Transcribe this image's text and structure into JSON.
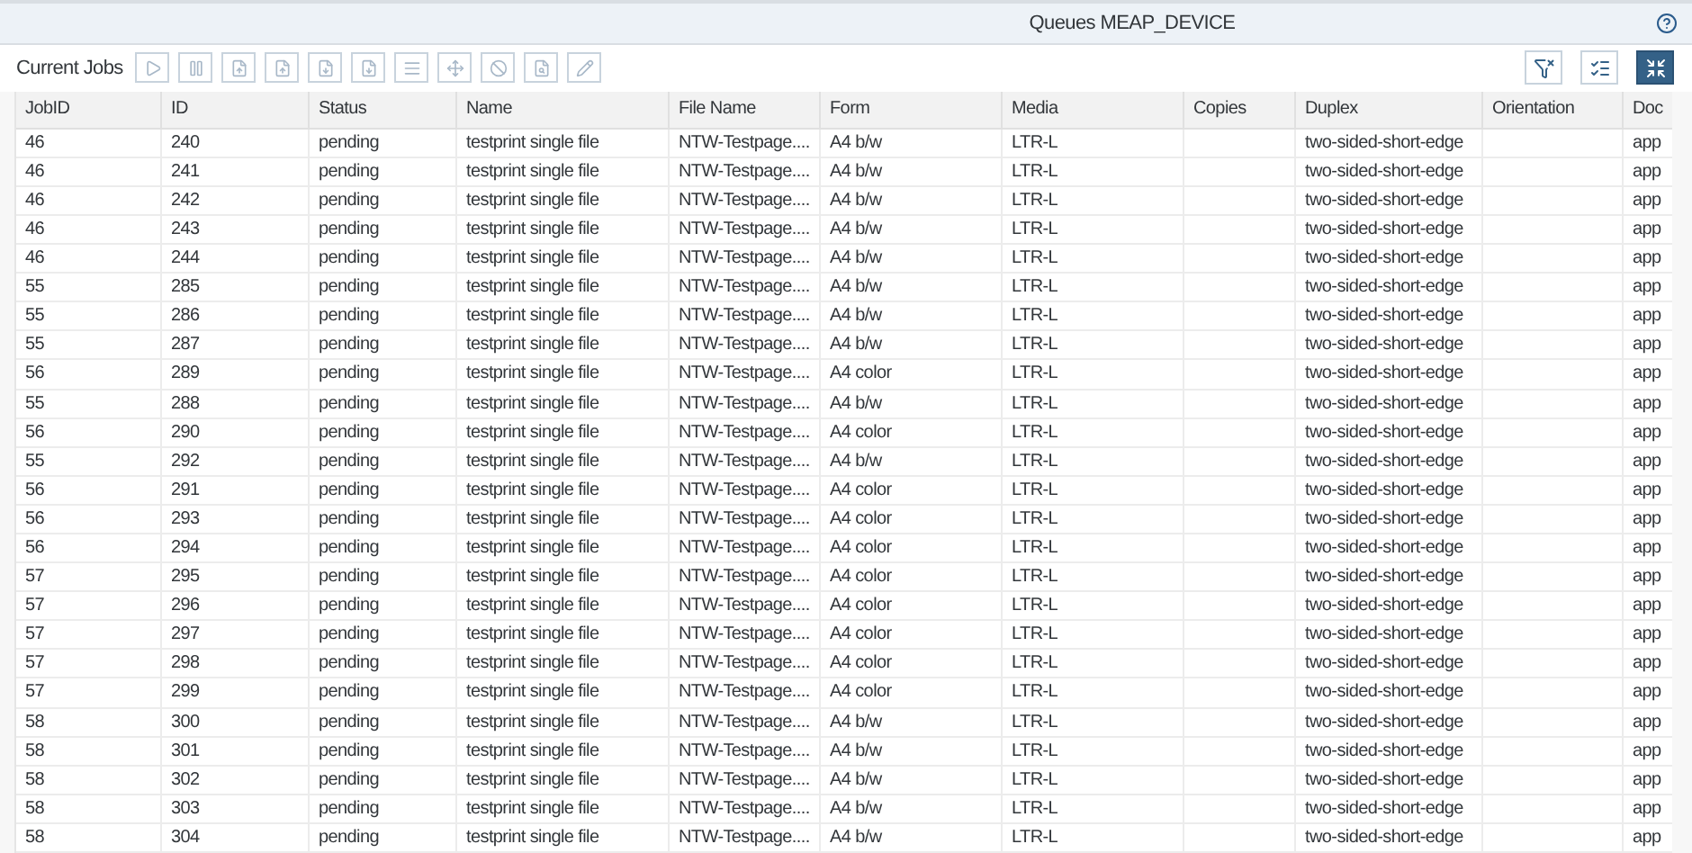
{
  "window": {
    "title": "Queues MEAP_DEVICE"
  },
  "toolbar": {
    "label": "Current Jobs",
    "toggles": [
      {
        "selected": false
      },
      {
        "selected": false
      },
      {
        "selected": true
      }
    ]
  },
  "table": {
    "columns": [
      "JobID",
      "ID",
      "Status",
      "Name",
      "File Name",
      "Form",
      "Media",
      "Copies",
      "Duplex",
      "Orientation",
      "Doc"
    ],
    "rows": [
      [
        "46",
        "240",
        "pending",
        "testprint single file",
        "NTW-Testpage....",
        "A4 b/w",
        "LTR-L",
        "",
        "two-sided-short-edge",
        "",
        "app"
      ],
      [
        "46",
        "241",
        "pending",
        "testprint single file",
        "NTW-Testpage....",
        "A4 b/w",
        "LTR-L",
        "",
        "two-sided-short-edge",
        "",
        "app"
      ],
      [
        "46",
        "242",
        "pending",
        "testprint single file",
        "NTW-Testpage....",
        "A4 b/w",
        "LTR-L",
        "",
        "two-sided-short-edge",
        "",
        "app"
      ],
      [
        "46",
        "243",
        "pending",
        "testprint single file",
        "NTW-Testpage....",
        "A4 b/w",
        "LTR-L",
        "",
        "two-sided-short-edge",
        "",
        "app"
      ],
      [
        "46",
        "244",
        "pending",
        "testprint single file",
        "NTW-Testpage....",
        "A4 b/w",
        "LTR-L",
        "",
        "two-sided-short-edge",
        "",
        "app"
      ],
      [
        "55",
        "285",
        "pending",
        "testprint single file",
        "NTW-Testpage....",
        "A4 b/w",
        "LTR-L",
        "",
        "two-sided-short-edge",
        "",
        "app"
      ],
      [
        "55",
        "286",
        "pending",
        "testprint single file",
        "NTW-Testpage....",
        "A4 b/w",
        "LTR-L",
        "",
        "two-sided-short-edge",
        "",
        "app"
      ],
      [
        "55",
        "287",
        "pending",
        "testprint single file",
        "NTW-Testpage....",
        "A4 b/w",
        "LTR-L",
        "",
        "two-sided-short-edge",
        "",
        "app"
      ],
      [
        "56",
        "289",
        "pending",
        "testprint single file",
        "NTW-Testpage....",
        "A4 color",
        "LTR-L",
        "",
        "two-sided-short-edge",
        "",
        "app"
      ],
      [
        "55",
        "288",
        "pending",
        "testprint single file",
        "NTW-Testpage....",
        "A4 b/w",
        "LTR-L",
        "",
        "two-sided-short-edge",
        "",
        "app"
      ],
      [
        "56",
        "290",
        "pending",
        "testprint single file",
        "NTW-Testpage....",
        "A4 color",
        "LTR-L",
        "",
        "two-sided-short-edge",
        "",
        "app"
      ],
      [
        "55",
        "292",
        "pending",
        "testprint single file",
        "NTW-Testpage....",
        "A4 b/w",
        "LTR-L",
        "",
        "two-sided-short-edge",
        "",
        "app"
      ],
      [
        "56",
        "291",
        "pending",
        "testprint single file",
        "NTW-Testpage....",
        "A4 color",
        "LTR-L",
        "",
        "two-sided-short-edge",
        "",
        "app"
      ],
      [
        "56",
        "293",
        "pending",
        "testprint single file",
        "NTW-Testpage....",
        "A4 color",
        "LTR-L",
        "",
        "two-sided-short-edge",
        "",
        "app"
      ],
      [
        "56",
        "294",
        "pending",
        "testprint single file",
        "NTW-Testpage....",
        "A4 color",
        "LTR-L",
        "",
        "two-sided-short-edge",
        "",
        "app"
      ],
      [
        "57",
        "295",
        "pending",
        "testprint single file",
        "NTW-Testpage....",
        "A4 color",
        "LTR-L",
        "",
        "two-sided-short-edge",
        "",
        "app"
      ],
      [
        "57",
        "296",
        "pending",
        "testprint single file",
        "NTW-Testpage....",
        "A4 color",
        "LTR-L",
        "",
        "two-sided-short-edge",
        "",
        "app"
      ],
      [
        "57",
        "297",
        "pending",
        "testprint single file",
        "NTW-Testpage....",
        "A4 color",
        "LTR-L",
        "",
        "two-sided-short-edge",
        "",
        "app"
      ],
      [
        "57",
        "298",
        "pending",
        "testprint single file",
        "NTW-Testpage....",
        "A4 color",
        "LTR-L",
        "",
        "two-sided-short-edge",
        "",
        "app"
      ],
      [
        "57",
        "299",
        "pending",
        "testprint single file",
        "NTW-Testpage....",
        "A4 color",
        "LTR-L",
        "",
        "two-sided-short-edge",
        "",
        "app"
      ],
      [
        "58",
        "300",
        "pending",
        "testprint single file",
        "NTW-Testpage....",
        "A4 b/w",
        "LTR-L",
        "",
        "two-sided-short-edge",
        "",
        "app"
      ],
      [
        "58",
        "301",
        "pending",
        "testprint single file",
        "NTW-Testpage....",
        "A4 b/w",
        "LTR-L",
        "",
        "two-sided-short-edge",
        "",
        "app"
      ],
      [
        "58",
        "302",
        "pending",
        "testprint single file",
        "NTW-Testpage....",
        "A4 b/w",
        "LTR-L",
        "",
        "two-sided-short-edge",
        "",
        "app"
      ],
      [
        "58",
        "303",
        "pending",
        "testprint single file",
        "NTW-Testpage....",
        "A4 b/w",
        "LTR-L",
        "",
        "two-sided-short-edge",
        "",
        "app"
      ],
      [
        "58",
        "304",
        "pending",
        "testprint single file",
        "NTW-Testpage....",
        "A4 b/w",
        "LTR-L",
        "",
        "two-sided-short-edge",
        "",
        "app"
      ]
    ]
  }
}
